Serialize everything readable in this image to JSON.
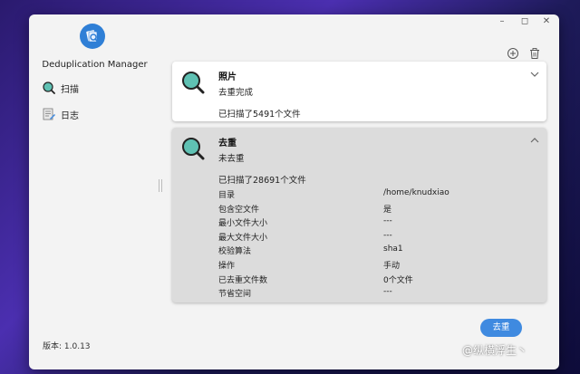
{
  "app": {
    "title": "Deduplication Manager",
    "version": "版本: 1.0.13"
  },
  "window": {
    "controls": [
      "minimize-icon",
      "maximize-icon",
      "close-icon"
    ]
  },
  "toolbar": {
    "add_icon": "plus-circle-icon",
    "delete_icon": "trash-icon"
  },
  "sidebar": {
    "items": [
      {
        "label": "扫描",
        "icon": "scan-magnifier-icon"
      },
      {
        "label": "日志",
        "icon": "log-document-icon"
      }
    ]
  },
  "cards": [
    {
      "title": "照片",
      "status": "去重完成",
      "summary": "已扫描了5491个文件",
      "expanded": false
    },
    {
      "title": "去重",
      "status": "未去重",
      "summary": "已扫描了28691个文件",
      "expanded": true,
      "details": [
        {
          "label": "目录",
          "value": "/home/knudxiao"
        },
        {
          "label": "包含空文件",
          "value": "是"
        },
        {
          "label": "最小文件大小",
          "value": "---"
        },
        {
          "label": "最大文件大小",
          "value": "---"
        },
        {
          "label": "校验算法",
          "value": "sha1"
        },
        {
          "label": "操作",
          "value": "手动"
        },
        {
          "label": "已去重文件数",
          "value": "0个文件"
        },
        {
          "label": "节省空间",
          "value": "---"
        }
      ]
    }
  ],
  "actions": {
    "dedupe_button": "去重"
  },
  "watermark": "@纵横浮生丶",
  "colors": {
    "accent": "#3f8ae0",
    "icon_teal": "#5fc1b3",
    "card_expanded_bg": "#dcdcdc"
  }
}
